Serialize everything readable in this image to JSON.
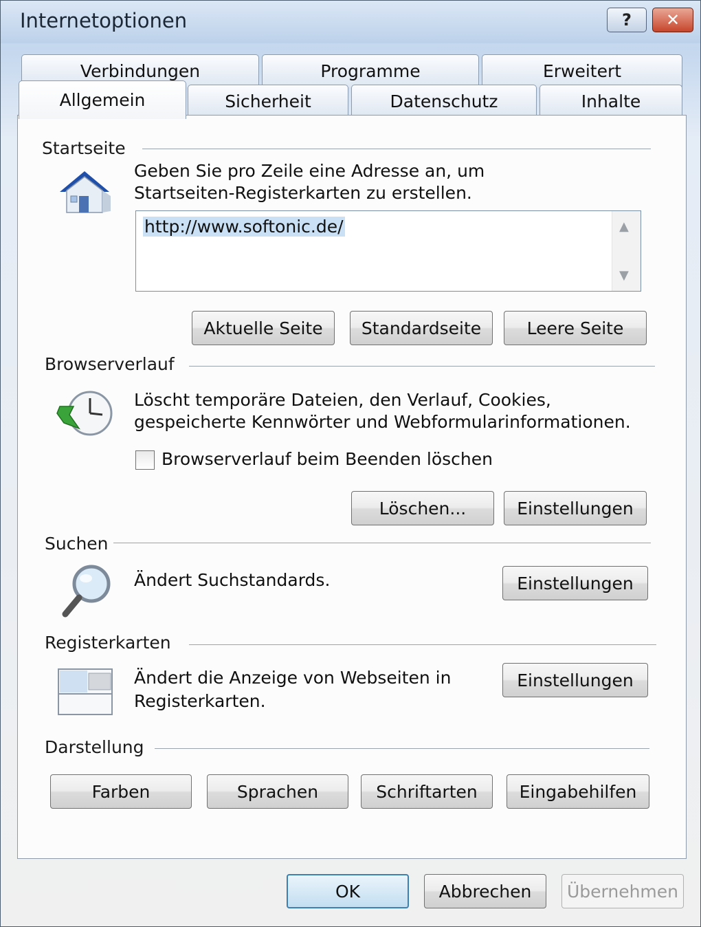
{
  "window": {
    "title": "Internetoptionen",
    "help_label": "?",
    "close_label": "✕"
  },
  "tabs": {
    "row1": [
      "Verbindungen",
      "Programme",
      "Erweitert"
    ],
    "row2": [
      "Allgemein",
      "Sicherheit",
      "Datenschutz",
      "Inhalte"
    ],
    "active": "Allgemein"
  },
  "startseite": {
    "heading": "Startseite",
    "description_1": "Geben Sie pro Zeile eine Adresse an, um",
    "description_2": "Startseiten-Registerkarten zu erstellen.",
    "url_value": "http://www.softonic.de/",
    "btn_current": "Aktuelle Seite",
    "btn_default": "Standardseite",
    "btn_blank": "Leere Seite",
    "icon": "house-icon"
  },
  "browserverlauf": {
    "heading": "Browserverlauf",
    "description_1": "Löscht temporäre Dateien, den Verlauf, Cookies,",
    "description_2": "gespeicherte Kennwörter und Webformularinformationen.",
    "checkbox_label": "Browserverlauf beim Beenden löschen",
    "checkbox_checked": false,
    "btn_delete": "Löschen...",
    "btn_settings": "Einstellungen",
    "icon": "history-clock-icon"
  },
  "suchen": {
    "heading": "Suchen",
    "description": "Ändert Suchstandards.",
    "btn_settings": "Einstellungen",
    "icon": "magnifier-icon"
  },
  "registerkarten": {
    "heading": "Registerkarten",
    "description_1": "Ändert die Anzeige von Webseiten in",
    "description_2": "Registerkarten.",
    "btn_settings": "Einstellungen",
    "icon": "tabs-window-icon"
  },
  "darstellung": {
    "heading": "Darstellung",
    "btn_colors": "Farben",
    "btn_languages": "Sprachen",
    "btn_fonts": "Schriftarten",
    "btn_accessibility": "Eingabehilfen"
  },
  "footer": {
    "ok": "OK",
    "cancel": "Abbrechen",
    "apply": "Übernehmen"
  }
}
